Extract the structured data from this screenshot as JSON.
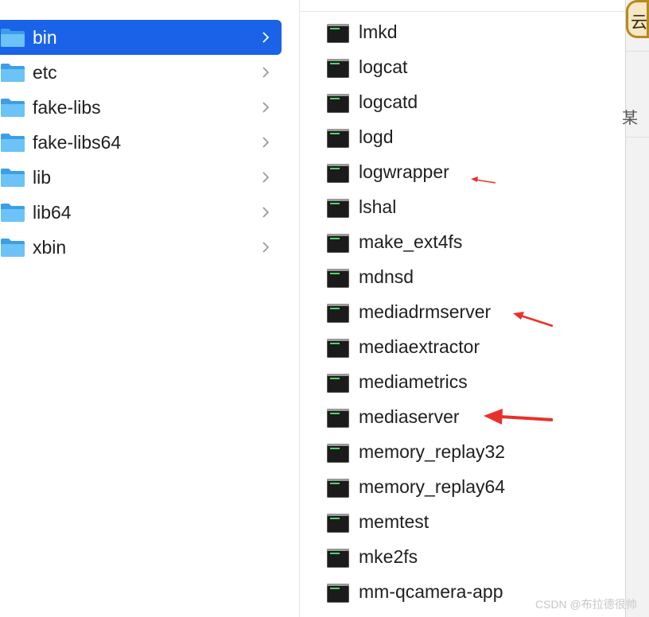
{
  "folders": [
    {
      "label": "bin",
      "selected": true
    },
    {
      "label": "etc"
    },
    {
      "label": "fake-libs"
    },
    {
      "label": "fake-libs64"
    },
    {
      "label": "lib"
    },
    {
      "label": "lib64"
    },
    {
      "label": "xbin"
    }
  ],
  "files": [
    "lmkd",
    "logcat",
    "logcatd",
    "logd",
    "logwrapper",
    "lshal",
    "make_ext4fs",
    "mdnsd",
    "mediadrmserver",
    "mediaextractor",
    "mediametrics",
    "mediaserver",
    "memory_replay32",
    "memory_replay64",
    "memtest",
    "mke2fs",
    "mm-qcamera-app"
  ],
  "annotations": {
    "color": "#e8312a",
    "targets": [
      "logwrapper",
      "mediadrmserver",
      "mediaserver"
    ]
  },
  "side_panel": {
    "button_char": "云",
    "char": "某"
  },
  "watermark": "CSDN @布拉德很帅",
  "colors": {
    "selection": "#1a63e8",
    "folder": "#5ab4f2"
  }
}
